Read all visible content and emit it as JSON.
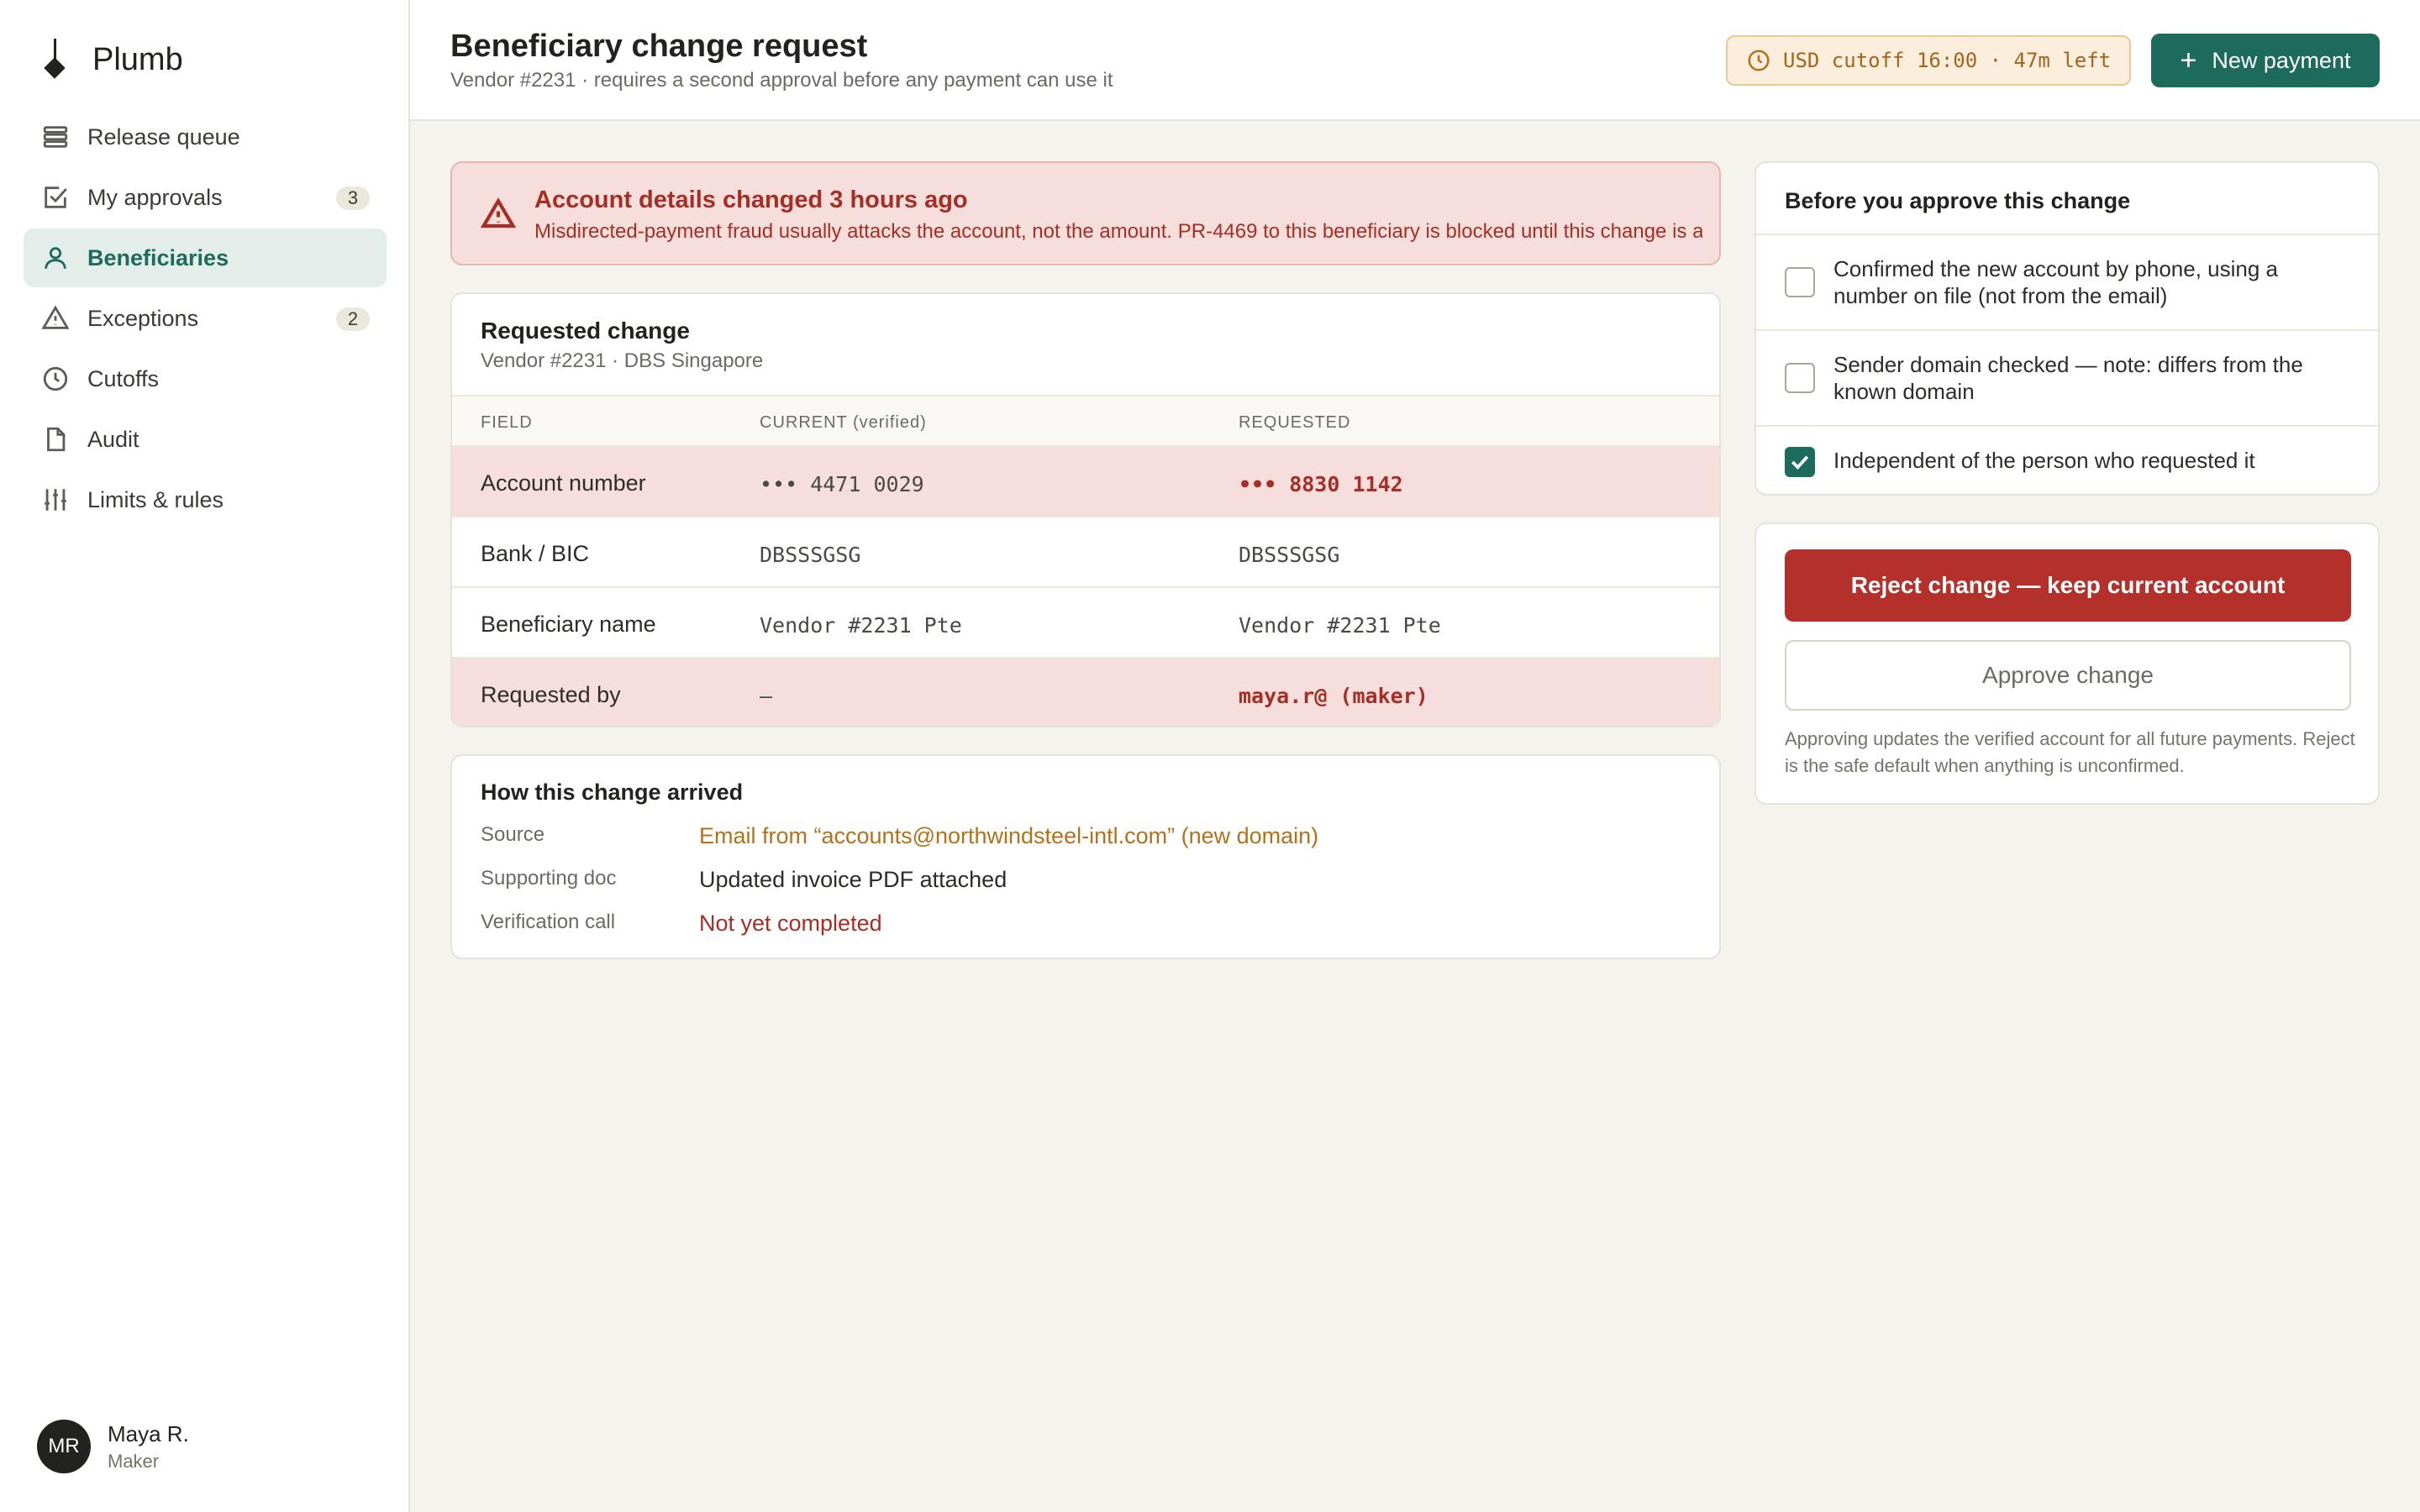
{
  "app": {
    "name": "Plumb"
  },
  "sidebar": {
    "items": [
      {
        "label": "Release queue",
        "icon": "stack-icon",
        "badge": ""
      },
      {
        "label": "My approvals",
        "icon": "check-square-icon",
        "badge": "3"
      },
      {
        "label": "Beneficiaries",
        "icon": "person-icon",
        "badge": "",
        "active": true
      },
      {
        "label": "Exceptions",
        "icon": "warning-icon",
        "badge": "2"
      },
      {
        "label": "Cutoffs",
        "icon": "clock-icon",
        "badge": ""
      },
      {
        "label": "Audit",
        "icon": "document-icon",
        "badge": ""
      },
      {
        "label": "Limits & rules",
        "icon": "sliders-icon",
        "badge": ""
      }
    ]
  },
  "user": {
    "initials": "MR",
    "name": "Maya R.",
    "role": "Maker"
  },
  "header": {
    "title": "Beneficiary change request",
    "subtitle": "Vendor #2231 · requires a second approval before any payment can use it",
    "cutoff": "USD cutoff 16:00 · 47m left",
    "new_payment": "New payment"
  },
  "alert": {
    "title": "Account details changed 3 hours ago",
    "body": "Misdirected-payment fraud usually attacks the account, not the amount. PR-4469 to this beneficiary is blocked until this change is approved."
  },
  "requested_change": {
    "title": "Requested change",
    "subtitle": "Vendor #2231 · DBS Singapore",
    "columns": [
      "FIELD",
      "CURRENT (verified)",
      "REQUESTED"
    ],
    "rows": [
      {
        "field": "Account number",
        "current": "••• 4471 0029",
        "requested": "••• 8830 1142",
        "changed": true
      },
      {
        "field": "Bank / BIC",
        "current": "DBSSSGSG",
        "requested": "DBSSSGSG",
        "changed": false
      },
      {
        "field": "Beneficiary name",
        "current": "Vendor #2231 Pte",
        "requested": "Vendor #2231 Pte",
        "changed": false
      },
      {
        "field": "Requested by",
        "current": "—",
        "requested": "maya.r@ (maker)",
        "changed": true
      }
    ]
  },
  "how": {
    "title": "How this change arrived",
    "rows": [
      {
        "key": "Source",
        "value": "Email from “accounts@northwindsteel-intl.com” (new domain)",
        "tone": "warn"
      },
      {
        "key": "Supporting doc",
        "value": "Updated invoice PDF attached",
        "tone": "normal"
      },
      {
        "key": "Verification call",
        "value": "Not yet completed",
        "tone": "bad"
      }
    ]
  },
  "checklist": {
    "title": "Before you approve this change",
    "items": [
      {
        "text": "Confirmed the new account by phone, using a number on file (not from the email)",
        "checked": false
      },
      {
        "text": "Sender domain checked — note: differs from the known domain",
        "checked": false
      },
      {
        "text": "Independent of the person who requested it",
        "checked": true
      }
    ]
  },
  "actions": {
    "reject": "Reject change — keep current account",
    "approve": "Approve change",
    "note": "Approving updates the verified account for all future payments. Reject is the safe default when anything is unconfirmed."
  },
  "colors": {
    "accent": "#1d6b5d",
    "danger": "#b3312a",
    "warning": "#b5701a",
    "background": "#f5f3ee"
  }
}
